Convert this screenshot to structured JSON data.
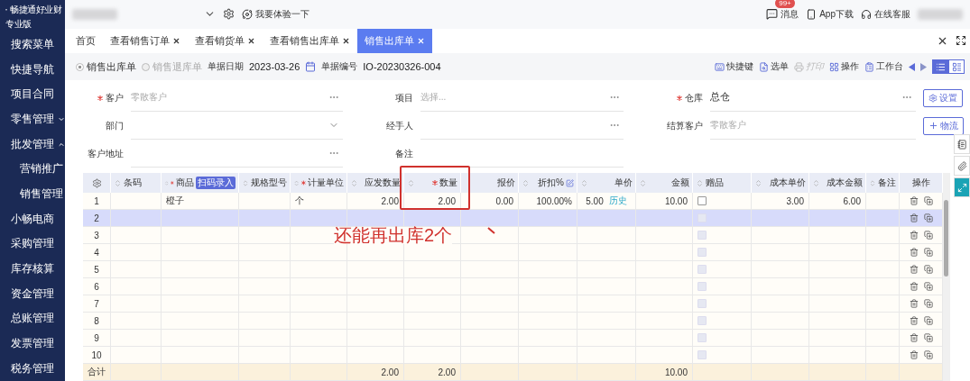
{
  "brand": {
    "name": "畅捷通好业财",
    "edition": "专业版"
  },
  "sidebar": {
    "items": [
      {
        "label": "搜索菜单"
      },
      {
        "label": "快捷导航"
      },
      {
        "label": "项目合同"
      },
      {
        "label": "零售管理",
        "expanded": false
      },
      {
        "label": "批发管理",
        "expanded": true,
        "children": [
          {
            "label": "营销推广"
          },
          {
            "label": "销售管理"
          }
        ]
      },
      {
        "label": "小畅电商"
      },
      {
        "label": "采购管理"
      },
      {
        "label": "库存核算"
      },
      {
        "label": "资金管理"
      },
      {
        "label": "总账管理"
      },
      {
        "label": "发票管理"
      },
      {
        "label": "税务管理"
      }
    ]
  },
  "topbar": {
    "try_link": "我要体验一下",
    "messages": {
      "label": "消息",
      "badge": "99+"
    },
    "app_download": "App下载",
    "support": "在线客服"
  },
  "tabs": [
    {
      "label": "首页",
      "closable": false,
      "selected": false
    },
    {
      "label": "查看销售订单",
      "closable": true,
      "selected": false
    },
    {
      "label": "查看销货单",
      "closable": true,
      "selected": false
    },
    {
      "label": "查看销售出库单",
      "closable": true,
      "selected": false
    },
    {
      "label": "销售出库单",
      "closable": true,
      "selected": true
    }
  ],
  "toolbar": {
    "doc_types": [
      {
        "label": "销售出库单",
        "selected": true
      },
      {
        "label": "销售退库单",
        "selected": false
      }
    ],
    "date_label": "单据日期",
    "date": "2023-03-26",
    "number_label": "单据编号",
    "number": "IO-20230326-004",
    "actions": [
      {
        "label": "快捷键",
        "disabled": false
      },
      {
        "label": "选单",
        "disabled": false
      },
      {
        "label": "打印",
        "disabled": true
      },
      {
        "label": "操作",
        "disabled": false
      },
      {
        "label": "工作台",
        "disabled": false
      }
    ],
    "views": [
      {
        "kind": "list",
        "selected": true
      },
      {
        "kind": "detail",
        "selected": false
      }
    ]
  },
  "form": {
    "rows": [
      [
        {
          "label": "客户",
          "required": true,
          "placeholder": "零散客户",
          "kind": "ellipsis"
        },
        {
          "label": "项目",
          "required": false,
          "placeholder": "选择...",
          "kind": "ellipsis"
        },
        {
          "label": "仓库",
          "required": true,
          "value": "总仓",
          "kind": "ellipsis"
        }
      ],
      [
        {
          "label": "部门",
          "required": false,
          "kind": "dropdown"
        },
        {
          "label": "经手人",
          "required": false,
          "kind": "ellipsis"
        },
        {
          "label": "结算客户",
          "required": false,
          "placeholder": "零散客户",
          "kind": "plain"
        }
      ],
      [
        {
          "label": "客户地址",
          "required": false,
          "kind": "ellipsis"
        },
        {
          "label": "备注",
          "required": false,
          "kind": "plain"
        }
      ]
    ],
    "buttons": [
      {
        "label": "设置",
        "kind": "settings"
      },
      {
        "label": "物流",
        "kind": "add"
      }
    ]
  },
  "table": {
    "columns": [
      {
        "kind": "settings"
      },
      {
        "kind": "text",
        "label": "条码",
        "sortable": true,
        "required": false
      },
      {
        "kind": "text",
        "label": "商品",
        "sortable": true,
        "required": true,
        "badge": "扫码录入"
      },
      {
        "kind": "text",
        "label": "规格型号",
        "sortable": true,
        "required": false
      },
      {
        "kind": "text",
        "label": "计量单位",
        "sortable": true,
        "required": true
      },
      {
        "kind": "number",
        "label": "应发数量",
        "sortable": true,
        "required": false
      },
      {
        "kind": "number",
        "label": "数量",
        "sortable": true,
        "required": true
      },
      {
        "kind": "number",
        "label": "报价",
        "sortable": false,
        "required": false
      },
      {
        "kind": "number",
        "label": "折扣%",
        "sortable": true,
        "required": false,
        "editable": true
      },
      {
        "kind": "price",
        "label": "单价",
        "sortable": true,
        "required": false
      },
      {
        "kind": "number",
        "label": "金额",
        "sortable": true,
        "required": false
      },
      {
        "kind": "gift",
        "label": "赠品",
        "sortable": true,
        "required": false
      },
      {
        "kind": "number",
        "label": "成本单价",
        "sortable": true,
        "required": false
      },
      {
        "kind": "number",
        "label": "成本金额",
        "sortable": true,
        "required": false
      },
      {
        "kind": "text",
        "label": "备注",
        "sortable": true,
        "required": false
      },
      {
        "kind": "actions",
        "label": "操作",
        "sortable": false,
        "required": false
      }
    ],
    "rows": [
      {
        "no": "1",
        "selected": false,
        "gift": {
          "checked": false,
          "disabled": false
        },
        "cells": [
          null,
          "橙子",
          null,
          "个",
          "2.00",
          "2.00",
          "0.00",
          "100.00%",
          {
            "value": "5.00",
            "link": "历史"
          },
          "10.00",
          "3.00",
          "6.00",
          null
        ]
      },
      {
        "no": "2",
        "selected": true,
        "gift": {
          "checked": false,
          "disabled": true
        }
      },
      {
        "no": "3",
        "selected": false,
        "gift": {
          "checked": false,
          "disabled": true
        }
      },
      {
        "no": "4",
        "selected": false,
        "gift": {
          "checked": false,
          "disabled": true
        }
      },
      {
        "no": "5",
        "selected": false,
        "gift": {
          "checked": false,
          "disabled": true
        }
      },
      {
        "no": "6",
        "selected": false,
        "gift": {
          "checked": false,
          "disabled": true
        }
      },
      {
        "no": "7",
        "selected": false,
        "gift": {
          "checked": false,
          "disabled": true
        }
      },
      {
        "no": "8",
        "selected": false,
        "gift": {
          "checked": false,
          "disabled": true
        }
      },
      {
        "no": "9",
        "selected": false,
        "gift": {
          "checked": false,
          "disabled": true
        }
      },
      {
        "no": "10",
        "selected": false,
        "gift": {
          "checked": false,
          "disabled": true
        }
      }
    ],
    "total": {
      "label": "合计",
      "cells": [
        null,
        null,
        null,
        null,
        "2.00",
        "2.00",
        null,
        null,
        null,
        "10.00",
        null,
        null,
        null
      ]
    }
  },
  "annotation": {
    "text": "还能再出库2个"
  }
}
